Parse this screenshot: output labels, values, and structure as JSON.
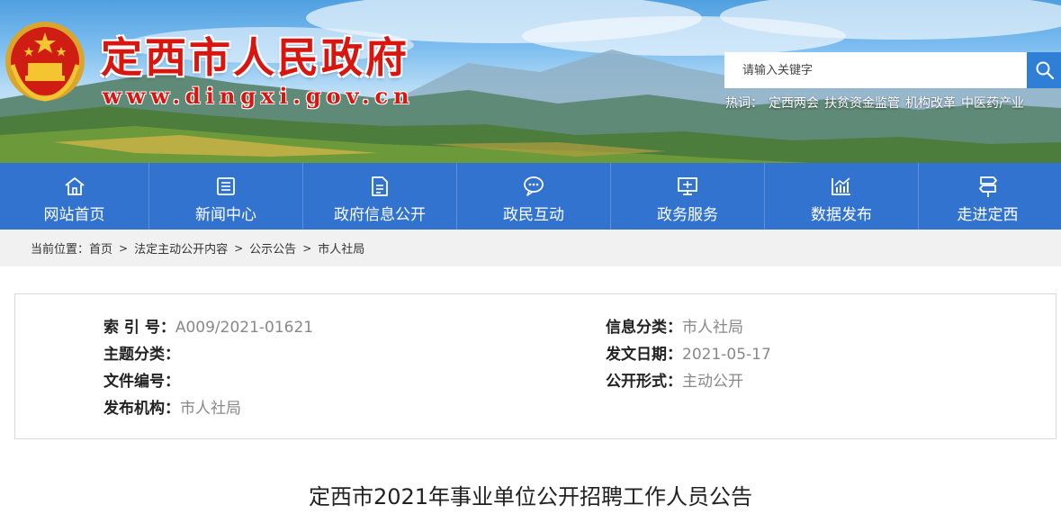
{
  "header": {
    "site_title": "定西市人民政府",
    "site_url": "www.dingxi.gov.cn",
    "title_color": "#d8160f"
  },
  "search": {
    "placeholder": "请输入关键字",
    "icon": "search-icon"
  },
  "hotwords": {
    "label": "热词：",
    "items": [
      "定西两会",
      "扶贫资金监管",
      "机构改革",
      "中医药产业"
    ]
  },
  "nav": {
    "background": "#3273d0",
    "items": [
      {
        "label": "网站首页",
        "icon": "home-icon"
      },
      {
        "label": "新闻中心",
        "icon": "news-icon"
      },
      {
        "label": "政府信息公开",
        "icon": "document-icon"
      },
      {
        "label": "政民互动",
        "icon": "chat-icon"
      },
      {
        "label": "政务服务",
        "icon": "monitor-icon"
      },
      {
        "label": "数据发布",
        "icon": "chart-icon"
      },
      {
        "label": "走进定西",
        "icon": "signpost-icon"
      }
    ]
  },
  "breadcrumb": {
    "prefix": "当前位置：",
    "items": [
      "首页",
      "法定主动公开内容",
      "公示公告",
      "市人社局"
    ],
    "separator": ">"
  },
  "info": {
    "index_no": {
      "label": "索 引 号：",
      "value": "A009/2021-01621"
    },
    "category": {
      "label": "信息分类：",
      "value": "市人社局"
    },
    "topic": {
      "label": "主题分类：",
      "value": ""
    },
    "date": {
      "label": "发文日期：",
      "value": "2021-05-17"
    },
    "doc_no": {
      "label": "文件编号：",
      "value": ""
    },
    "disclosure": {
      "label": "公开形式：",
      "value": "主动公开"
    },
    "publisher": {
      "label": "发布机构：",
      "value": "市人社局"
    }
  },
  "article": {
    "title": "定西市2021年事业单位公开招聘工作人员公告"
  }
}
